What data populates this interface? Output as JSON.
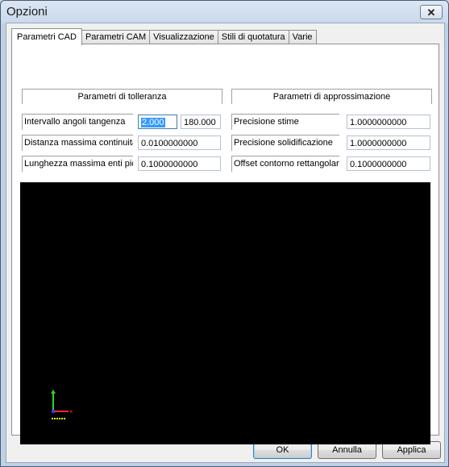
{
  "window": {
    "title": "Opzioni",
    "close_glyph": "✕"
  },
  "tabs": [
    "Parametri CAD",
    "Parametri CAM",
    "Visualizzazione",
    "Stili di quotatura",
    "Varie"
  ],
  "active_tab": "Parametri CAD",
  "tolerance": {
    "header": "Parametri di tolleranza",
    "rows": [
      {
        "label": "Intervallo angoli tangenza",
        "value1": "2.000",
        "value2": "180.000"
      },
      {
        "label": "Distanza massima continuità",
        "value1": "0.0100000000"
      },
      {
        "label": "Lunghezza massima enti pic",
        "value1": "0.1000000000"
      }
    ]
  },
  "approximation": {
    "header": "Parametri di approssimazione",
    "rows": [
      {
        "label": "Precisione stime",
        "value": "1.0000000000"
      },
      {
        "label": "Precisione solidificazione",
        "value": "1.0000000000"
      },
      {
        "label": "Offset contorno rettangolare",
        "value": "0.1000000000"
      }
    ]
  },
  "preview": {
    "axis_x_color": "#ff2a2a",
    "axis_y_color": "#2bd62b",
    "axis_label_color": "#ffff00"
  },
  "buttons": {
    "ok": "OK",
    "cancel": "Annulla",
    "apply": "Applica"
  }
}
